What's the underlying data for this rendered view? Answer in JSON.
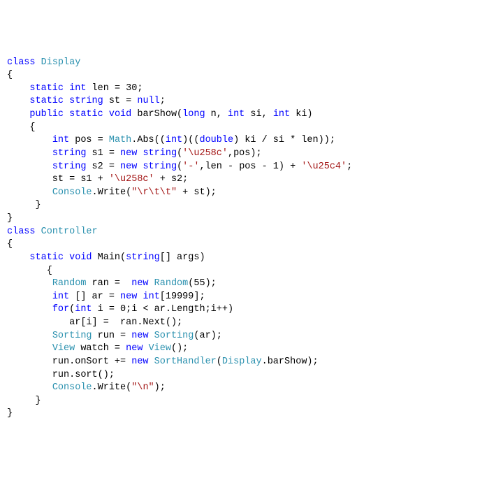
{
  "code": {
    "l01_a": "class",
    "l01_b": "Display",
    "l02": "{",
    "l03_a": "static",
    "l03_b": "int",
    "l03_c": " len = 30;",
    "l04_a": "static",
    "l04_b": "string",
    "l04_c": " st = ",
    "l04_d": "null",
    "l04_e": ";",
    "l05_a": "public",
    "l05_b": "static",
    "l05_c": "void",
    "l05_d": " barShow(",
    "l05_e": "long",
    "l05_f": " n, ",
    "l05_g": "int",
    "l05_h": " si, ",
    "l05_i": "int",
    "l05_j": " ki)",
    "l06": "    {",
    "l07_a": "int",
    "l07_b": " pos = ",
    "l07_c": "Math",
    "l07_d": ".Abs((",
    "l07_e": "int",
    "l07_f": ")((",
    "l07_g": "double",
    "l07_h": ") ki / si * len));",
    "l08_a": "string",
    "l08_b": " s1 = ",
    "l08_c": "new",
    "l08_d": "string",
    "l08_e": "(",
    "l08_f": "'\\u258c'",
    "l08_g": ",pos);",
    "l09_a": "string",
    "l09_b": " s2 = ",
    "l09_c": "new",
    "l09_d": "string",
    "l09_e": "(",
    "l09_f": "'-'",
    "l09_g": ",len - pos - 1) + ",
    "l09_h": "'\\u25c4'",
    "l09_i": ";",
    "l10_a": "        st = s1 + ",
    "l10_b": "'\\u258c'",
    "l10_c": " + s2;",
    "l11_a": "Console",
    "l11_b": ".Write(",
    "l11_c": "\"\\r\\t\\t\"",
    "l11_d": " + st);",
    "l12": "     }",
    "l13": "}",
    "l14_a": "class",
    "l14_b": "Controller",
    "l15": "{",
    "l16_a": "static",
    "l16_b": "void",
    "l16_c": " Main(",
    "l16_d": "string",
    "l16_e": "[] args)",
    "l17": "       {",
    "l18_a": "Random",
    "l18_b": " ran =  ",
    "l18_c": "new",
    "l18_d": "Random",
    "l18_e": "(55);",
    "l19_a": "int",
    "l19_b": " [] ar = ",
    "l19_c": "new",
    "l19_d": "int",
    "l19_e": "[19999];",
    "l20_a": "for",
    "l20_b": "(",
    "l20_c": "int",
    "l20_d": " i = 0;i < ar.Length;i++)",
    "l21": "           ar[i] =  ran.Next();",
    "l22_a": "Sorting",
    "l22_b": " run = ",
    "l22_c": "new",
    "l22_d": "Sorting",
    "l22_e": "(ar);",
    "l23_a": "View",
    "l23_b": " watch = ",
    "l23_c": "new",
    "l23_d": "View",
    "l23_e": "();",
    "l24_a": "        run.onSort += ",
    "l24_b": "new",
    "l24_c": "SortHandler",
    "l24_d": "(",
    "l24_e": "Display",
    "l24_f": ".barShow);",
    "l25": "        run.sort();",
    "l26_a": "Console",
    "l26_b": ".Write(",
    "l26_c": "\"\\n\"",
    "l26_d": ");",
    "l27": "     }",
    "l28": "}"
  }
}
